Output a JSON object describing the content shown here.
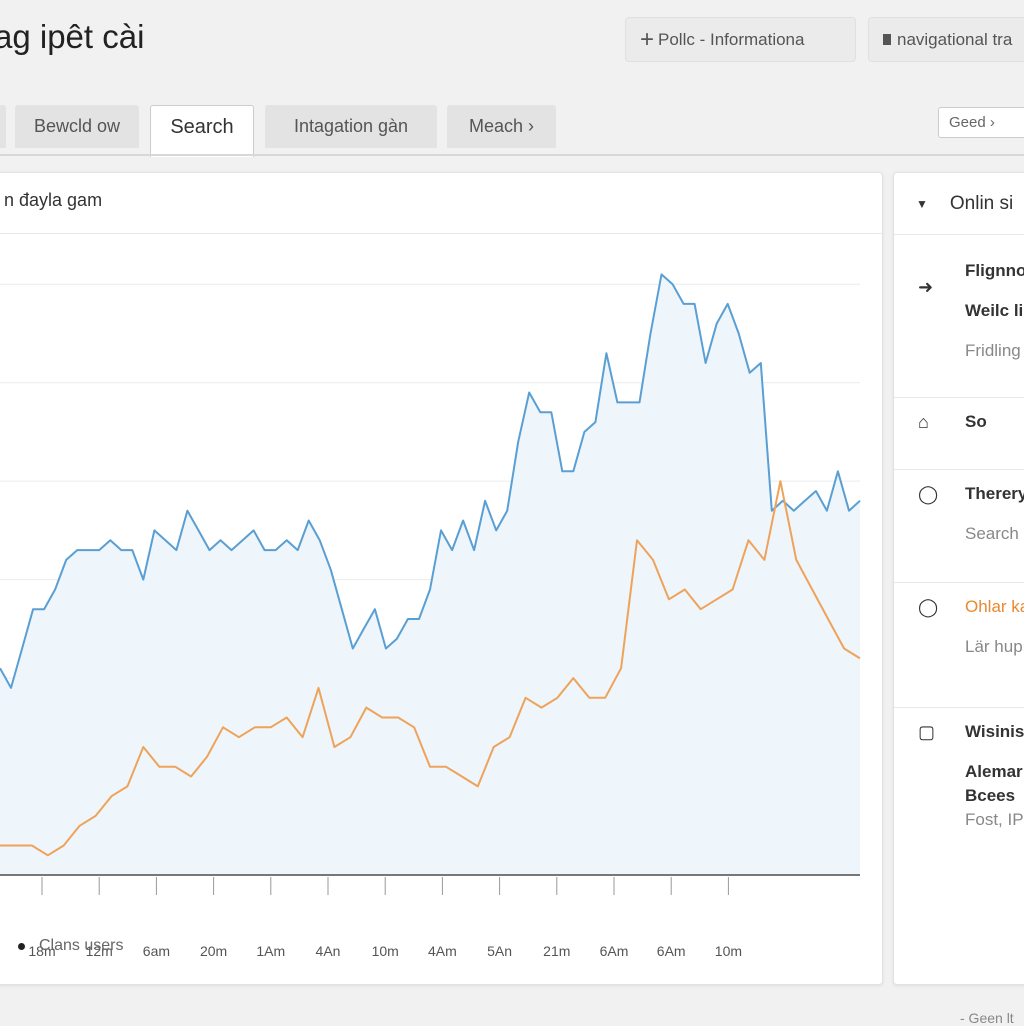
{
  "header": {
    "title": "ag ipêt cài",
    "buttons": [
      {
        "icon": "plus-icon",
        "label": "Pollc - Informationa"
      },
      {
        "icon": "doc-icon",
        "label": "navigational tra"
      }
    ]
  },
  "tabs": [
    {
      "label": ""
    },
    {
      "label": "Bewcld ow"
    },
    {
      "label": "Search",
      "active": true
    },
    {
      "label": "Intagation gàn"
    },
    {
      "label": "Meach ›"
    }
  ],
  "filter": {
    "value": "Geed ›"
  },
  "panel": {
    "title": "n đayla gam"
  },
  "chart_data": {
    "type": "area",
    "title": "",
    "xlabel": "",
    "ylabel": "",
    "grid": true,
    "ylim": [
      0,
      65
    ],
    "x_ticks": [
      "18m",
      "12m",
      "6am",
      "20m",
      "1Am",
      "4An",
      "10m",
      "4Am",
      "5An",
      "21m",
      "6Am",
      "6Am",
      "10m"
    ],
    "legend": {
      "placement": "bottom-left",
      "entries": [
        "Clans users"
      ]
    },
    "series": [
      {
        "color": "#5a9fd4",
        "values": [
          21,
          19,
          23,
          27,
          27,
          29,
          32,
          33,
          33,
          33,
          34,
          33,
          33,
          30,
          35,
          34,
          33,
          37,
          35,
          33,
          34,
          33,
          34,
          35,
          33,
          33,
          34,
          33,
          36,
          34,
          31,
          27,
          23,
          25,
          27,
          23,
          24,
          26,
          26,
          29,
          35,
          33,
          36,
          33,
          38,
          35,
          37,
          44,
          49,
          47,
          47,
          41,
          41,
          45,
          46,
          53,
          48,
          48,
          48,
          55,
          61,
          60,
          58,
          58,
          52,
          56,
          58,
          55,
          51,
          52,
          37,
          38,
          37,
          38,
          39,
          37,
          41,
          37,
          38
        ]
      },
      {
        "color": "#eea35a",
        "values": [
          3,
          3,
          3,
          2,
          3,
          5,
          6,
          8,
          9,
          13,
          11,
          11,
          10,
          12,
          15,
          14,
          15,
          15,
          16,
          14,
          19,
          13,
          14,
          17,
          16,
          16,
          15,
          11,
          11,
          10,
          9,
          13,
          14,
          18,
          17,
          18,
          20,
          18,
          18,
          21,
          34,
          32,
          28,
          29,
          27,
          28,
          29,
          34,
          32,
          40,
          32,
          29,
          26,
          23,
          22
        ]
      }
    ]
  },
  "side": {
    "header": "Onlin si",
    "items": [
      {
        "icon": "speaker-icon",
        "lines": [
          {
            "text": "Flignno",
            "style": "b"
          },
          {
            "text": "Weilc li",
            "style": "b"
          },
          {
            "text": "Fridling",
            "style": "g"
          }
        ]
      },
      {
        "icon": "bell-icon",
        "lines": [
          {
            "text": "So",
            "style": "b"
          }
        ]
      },
      {
        "icon": "ring-icon",
        "lines": [
          {
            "text": "Thereryi",
            "style": "b"
          },
          {
            "text": "Search",
            "style": "g"
          }
        ]
      },
      {
        "icon": "ring-icon",
        "lines": [
          {
            "text": "Ohlar ka",
            "style": "o"
          },
          {
            "text": "Lär hup",
            "style": "g"
          }
        ]
      },
      {
        "icon": "chat-icon",
        "lines": [
          {
            "text": "Wisinisi",
            "style": "b"
          },
          {
            "text": "Alemar",
            "style": "b"
          },
          {
            "text": "Bcees",
            "style": "b"
          },
          {
            "text": "Fost, IP",
            "style": "g"
          }
        ]
      }
    ]
  },
  "footer": "- Geen lt"
}
